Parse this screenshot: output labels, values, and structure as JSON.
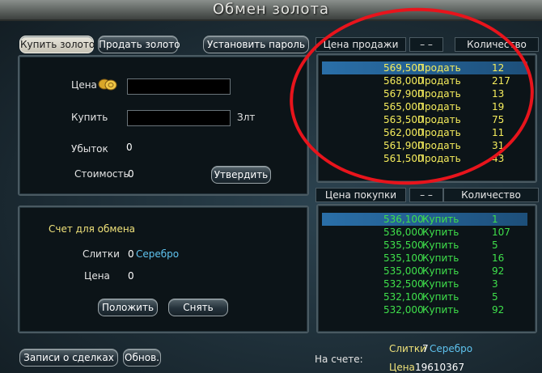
{
  "window": {
    "title": "Обмен золота"
  },
  "tabs": {
    "buy_gold": "Купить золото",
    "sell_gold": "Продать золото",
    "set_password": "Установить пароль"
  },
  "order_form": {
    "price_label": "Цена",
    "buy_label": "Купить",
    "buy_unit": "Злт",
    "loss_label": "Убыток",
    "loss_value": "0",
    "cost_label": "Стоимость",
    "cost_value": "0",
    "confirm_button": "Утвердить"
  },
  "exchange_account": {
    "title": "Счет для обмена",
    "ingots_label": "Слитки",
    "ingots_value": "0",
    "ingots_unit": "Серебро",
    "price_label": "Цена",
    "price_value": "0",
    "deposit_button": "Положить",
    "withdraw_button": "Снять"
  },
  "footer": {
    "deals_button": "Записи о сделках",
    "refresh_button": "Обнов.",
    "balance_label": "На счете:",
    "ingots_label": "Слитки",
    "ingots_value": "7",
    "ingots_unit": "Серебро",
    "price_label": "Цена",
    "price_value": "19610367"
  },
  "sell_table": {
    "headers": {
      "price": "Цена продажи",
      "dash": "– –",
      "quantity": "Количество"
    },
    "rows": [
      {
        "price": "569,500",
        "action": "Продать",
        "qty": "12",
        "selected": true
      },
      {
        "price": "568,000",
        "action": "Продать",
        "qty": "217"
      },
      {
        "price": "567,900",
        "action": "Продать",
        "qty": "13"
      },
      {
        "price": "565,000",
        "action": "Продать",
        "qty": "19"
      },
      {
        "price": "563,500",
        "action": "Продать",
        "qty": "75"
      },
      {
        "price": "562,000",
        "action": "Продать",
        "qty": "11"
      },
      {
        "price": "561,900",
        "action": "Продать",
        "qty": "31"
      },
      {
        "price": "561,500",
        "action": "Продать",
        "qty": "43"
      }
    ]
  },
  "buy_table": {
    "headers": {
      "price": "Цена покупки",
      "dash": "– –",
      "quantity": "Количество"
    },
    "rows": [
      {
        "price": "536,100",
        "action": "Купить",
        "qty": "1",
        "selected": true
      },
      {
        "price": "536,000",
        "action": "Купить",
        "qty": "107"
      },
      {
        "price": "535,500",
        "action": "Купить",
        "qty": "5"
      },
      {
        "price": "535,100",
        "action": "Купить",
        "qty": "16"
      },
      {
        "price": "535,000",
        "action": "Купить",
        "qty": "92"
      },
      {
        "price": "532,500",
        "action": "Купить",
        "qty": "3"
      },
      {
        "price": "532,100",
        "action": "Купить",
        "qty": "5"
      },
      {
        "price": "532,000",
        "action": "Купить",
        "qty": "92"
      }
    ]
  },
  "colors": {
    "highlight_circle": "#e8141c",
    "sell_text": "#f6ed5c",
    "buy_text": "#3fe04b",
    "silver_text": "#5fc3ef"
  },
  "icons": {
    "gold": "gold-coins-icon"
  }
}
